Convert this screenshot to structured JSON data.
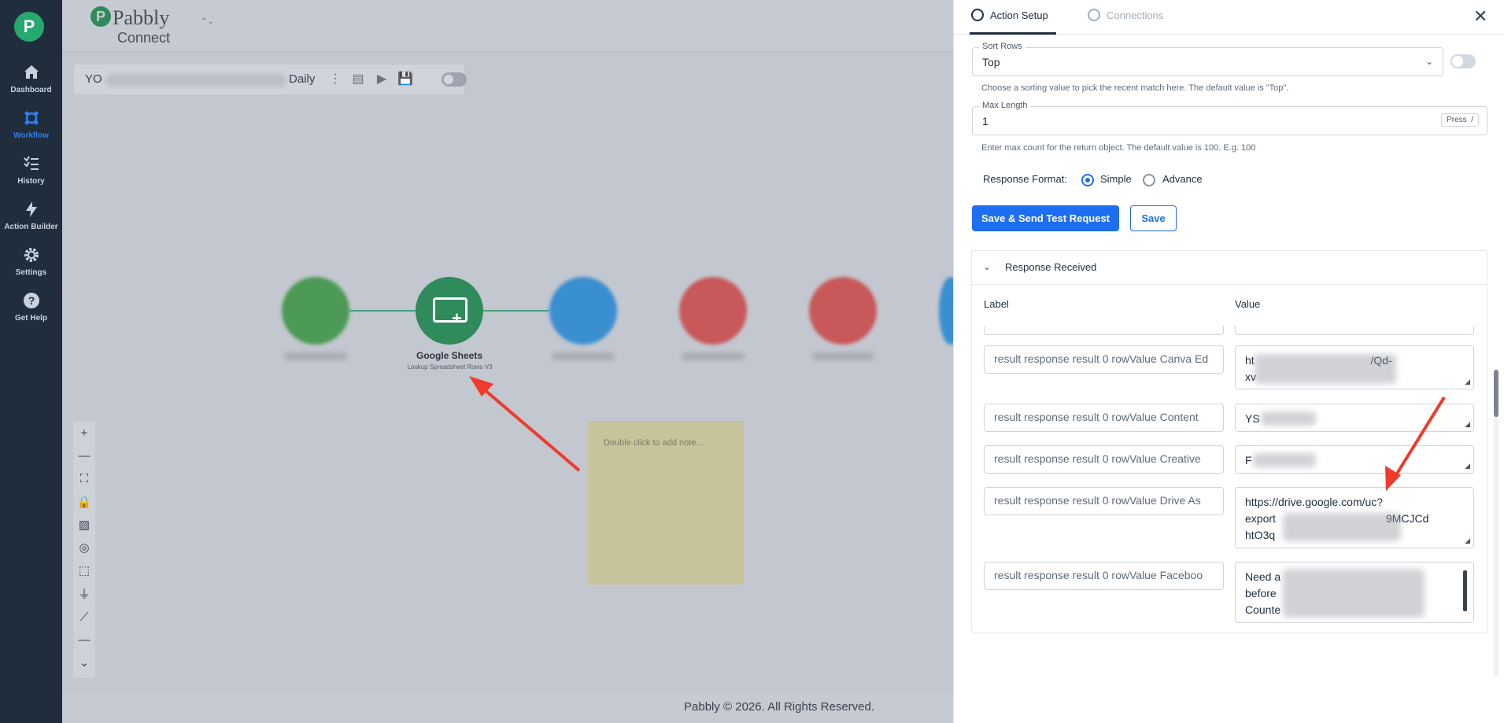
{
  "sidebar": {
    "logo": "P",
    "items": [
      {
        "label": "Dashboard",
        "icon": "home-icon"
      },
      {
        "label": "Workflow",
        "icon": "workflow-icon"
      },
      {
        "label": "History",
        "icon": "history-icon"
      },
      {
        "label": "Action Builder",
        "icon": "bolt-icon"
      },
      {
        "label": "Settings",
        "icon": "gear-icon"
      },
      {
        "label": "Get Help",
        "icon": "help-icon"
      }
    ]
  },
  "brand": {
    "name": "Pabbly",
    "sub": "Connect"
  },
  "workflow": {
    "name_start": "YO",
    "name_end": "Daily"
  },
  "node": {
    "title": "Google Sheets",
    "subtitle": "Lookup Spreadsheet Rows V3"
  },
  "note": {
    "placeholder": "Double click to add note..."
  },
  "footer": {
    "text": "Pabbly © 2026. All Rights Reserved."
  },
  "panel": {
    "tabs": {
      "active": "Action Setup",
      "inactive": "Connections"
    },
    "sort_rows": {
      "label": "Sort Rows",
      "value": "Top",
      "help": "Choose a sorting value to pick the recent match here. The default value is \"Top\"."
    },
    "max_length": {
      "label": "Max Length",
      "value": "1",
      "press": "Press",
      "press_key": "/",
      "help": "Enter max count for the return object. The default value is 100. E.g. 100"
    },
    "response_format": {
      "label": "Response Format:",
      "simple": "Simple",
      "advance": "Advance"
    },
    "buttons": {
      "save_send": "Save & Send Test Request",
      "save": "Save"
    },
    "response": {
      "title": "Response Received",
      "label_header": "Label",
      "value_header": "Value",
      "rows": [
        {
          "label": "result response result 0 rowValue Canva Ed",
          "value": "ht                                      /Qd-\nxv"
        },
        {
          "label": "result response result 0 rowValue Content",
          "value": "YS"
        },
        {
          "label": "result response result 0 rowValue Creative",
          "value": "F"
        },
        {
          "label": "result response result 0 rowValue Drive As",
          "value": "https://drive.google.com/uc?\nexport                                    9MCJCd\nhtO3q"
        },
        {
          "label": "result response result 0 rowValue Faceboo",
          "value": "Need a\nbefore\nCounte"
        }
      ]
    }
  },
  "colors": {
    "accent": "#1d6ef2",
    "sidebar": "#1f2d3d",
    "node": "#2f8a5c",
    "arrow": "#f03a2e"
  }
}
